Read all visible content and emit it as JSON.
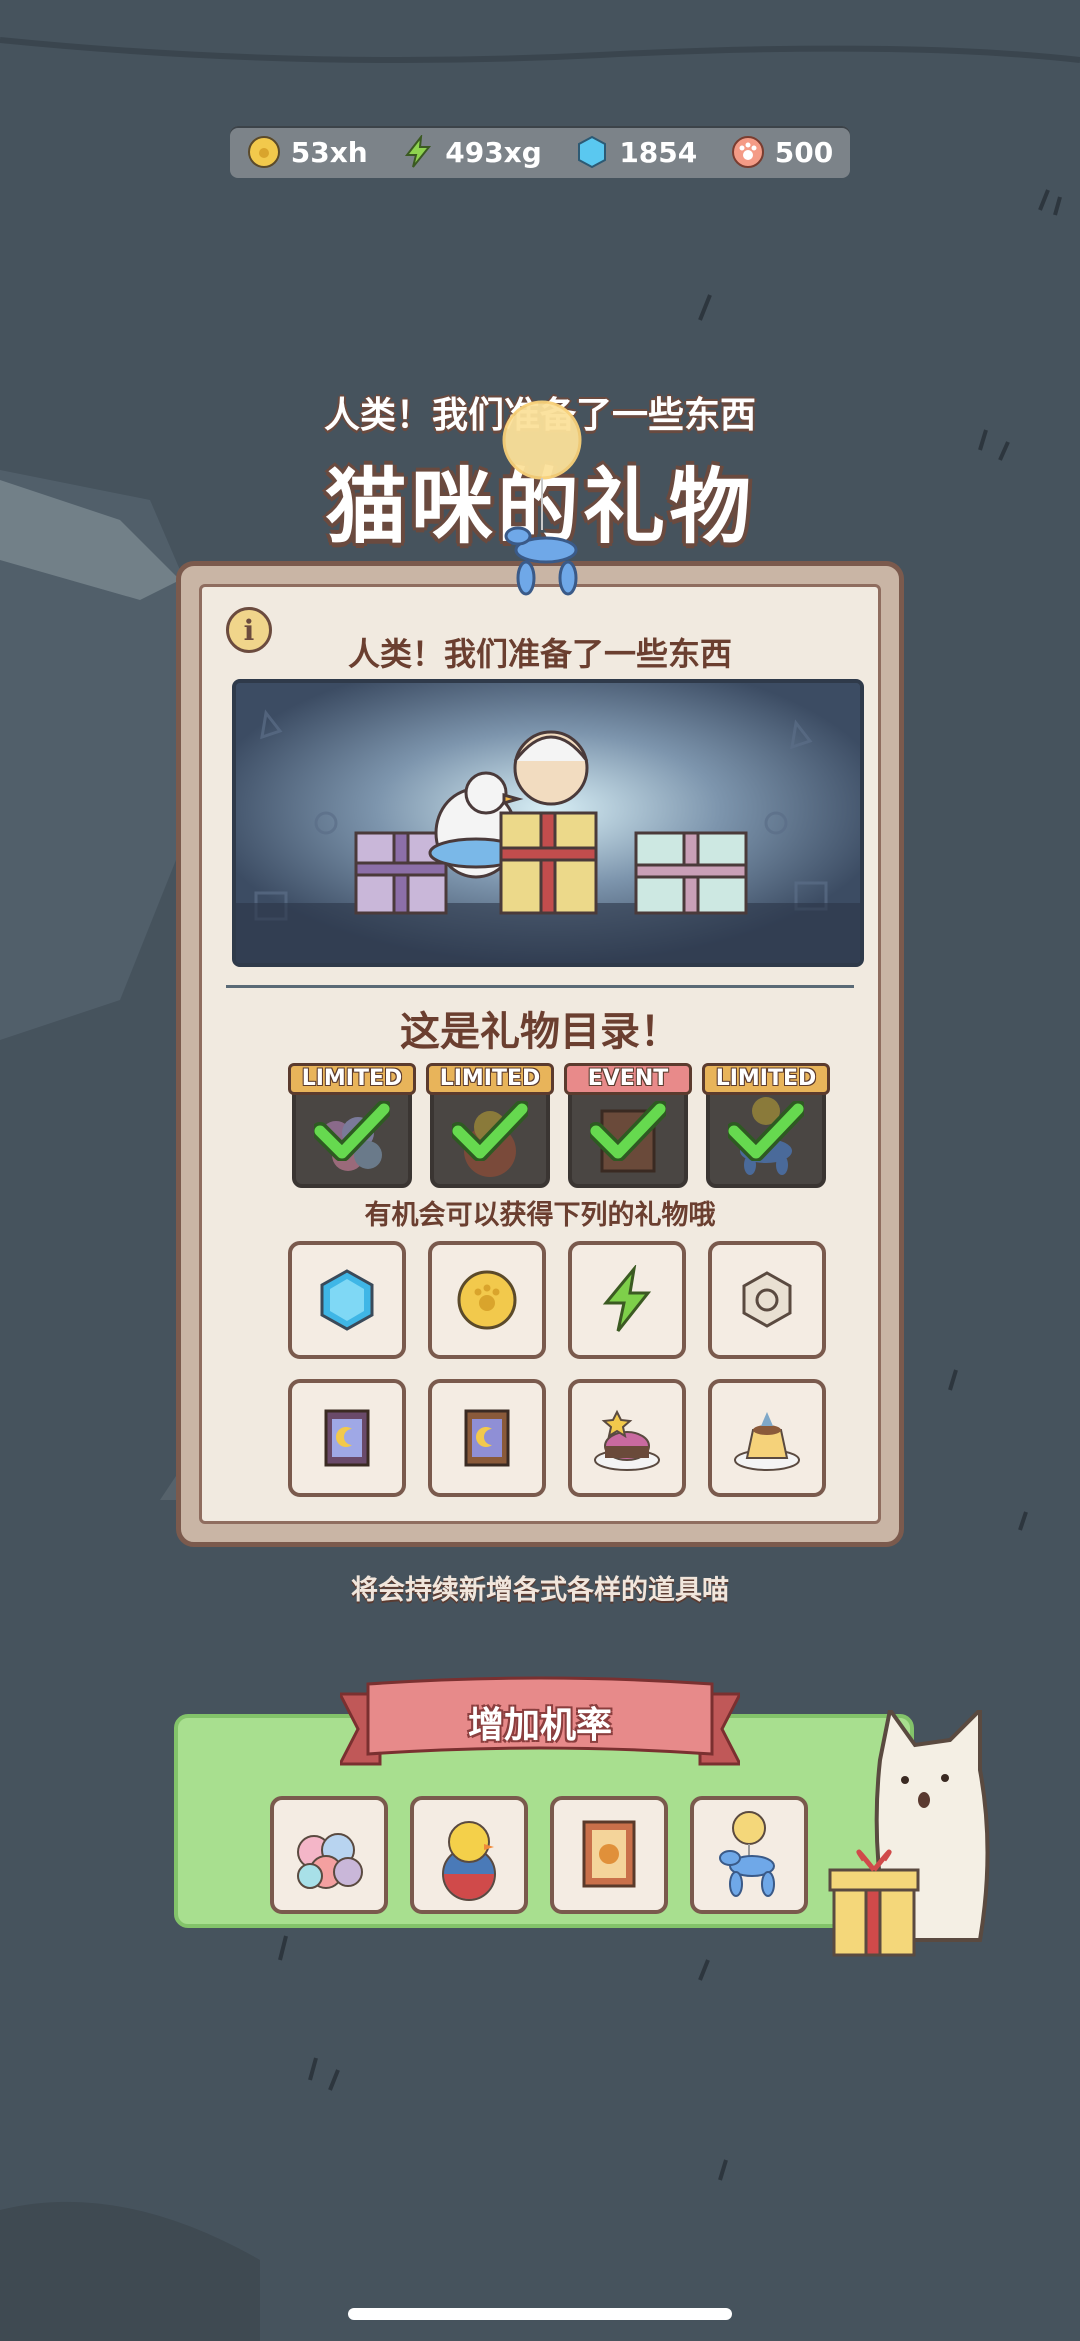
{
  "currency": {
    "coins": "53xh",
    "energy": "493xg",
    "gems": "1854",
    "paws": "500",
    "icons": [
      "coin-icon",
      "lightning-icon",
      "gem-icon",
      "paw-token-icon"
    ]
  },
  "header": {
    "subtitle": "人类！我们准备了一些东西",
    "title": "猫咪的礼物"
  },
  "panel": {
    "info_label": "i",
    "header": "人类！我们准备了一些东西",
    "catalog_title": "这是礼物目录！",
    "featured": [
      {
        "tag": "LIMITED",
        "icon": "balloon-bunch-icon",
        "owned": true
      },
      {
        "tag": "LIMITED",
        "icon": "duck-ball-icon",
        "owned": true
      },
      {
        "tag": "EVENT",
        "icon": "ticket-icon",
        "owned": true
      },
      {
        "tag": "LIMITED",
        "icon": "balloon-dog-icon",
        "owned": true
      }
    ],
    "chance_text": "有机会可以获得下列的礼物哦",
    "rewards": [
      "gem-icon",
      "coin-icon",
      "lightning-icon",
      "nut-icon",
      "moon-ticket-icon",
      "moon-ticket-icon",
      "star-cake-icon",
      "fish-pudding-icon"
    ]
  },
  "footnote": "将会持续新增各式各样的道具喵",
  "boost": {
    "label": "增加机率",
    "items": [
      "balloon-bunch-icon",
      "duck-ball-icon",
      "ticket-icon",
      "balloon-dog-icon"
    ]
  },
  "colors": {
    "background": "#46535d",
    "panel": "#f1eae0",
    "limited_tag": "#e8b45a",
    "event_tag": "#e88a8a",
    "boost_bg": "#a8df8f",
    "check": "#66d94f"
  }
}
